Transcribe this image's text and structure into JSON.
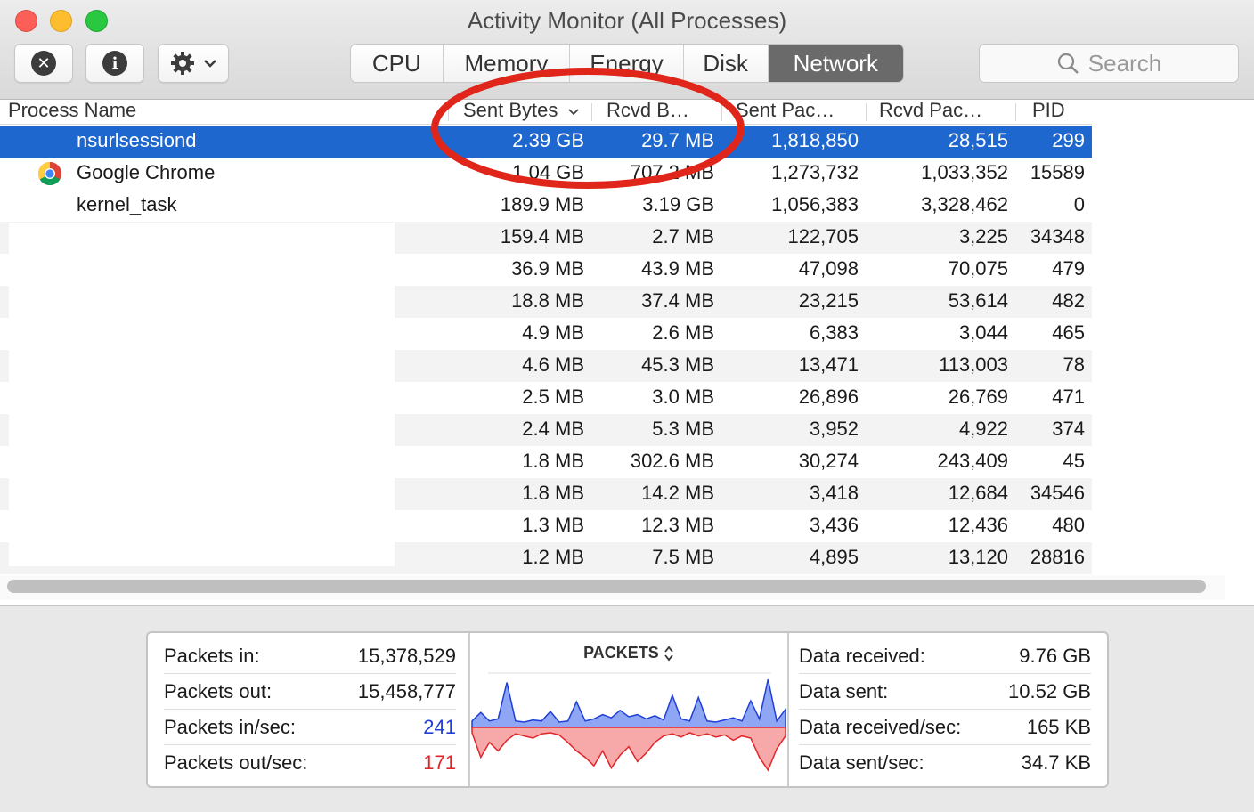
{
  "window": {
    "title": "Activity Monitor (All Processes)"
  },
  "toolbar": {
    "stop_icon": "x-circle-icon",
    "info_icon": "info-circle-icon",
    "gear_icon": "gear-icon"
  },
  "tabs": [
    {
      "label": "CPU",
      "active": false
    },
    {
      "label": "Memory",
      "active": false
    },
    {
      "label": "Energy",
      "active": false
    },
    {
      "label": "Disk",
      "active": false
    },
    {
      "label": "Network",
      "active": true
    }
  ],
  "search": {
    "placeholder": "Search"
  },
  "table": {
    "columns": {
      "process_name": "Process Name",
      "sent_bytes": "Sent Bytes",
      "rcvd_bytes": "Rcvd B…",
      "sent_packets": "Sent Pac…",
      "rcvd_packets": "Rcvd Pac…",
      "pid": "PID"
    },
    "sort_column": "Sent Bytes",
    "sort_direction": "descending",
    "rows": [
      {
        "name": "nsurlsessiond",
        "sent": "2.39 GB",
        "rcvd": "29.7 MB",
        "spk": "1,818,850",
        "rpk": "28,515",
        "pid": "299",
        "selected": true
      },
      {
        "name": "Google Chrome",
        "sent": "1.04 GB",
        "rcvd": "707.2 MB",
        "spk": "1,273,732",
        "rpk": "1,033,352",
        "pid": "15589",
        "icon": "chrome-icon"
      },
      {
        "name": "kernel_task",
        "sent": "189.9 MB",
        "rcvd": "3.19 GB",
        "spk": "1,056,383",
        "rpk": "3,328,462",
        "pid": "0"
      },
      {
        "name": "",
        "sent": "159.4 MB",
        "rcvd": "2.7 MB",
        "spk": "122,705",
        "rpk": "3,225",
        "pid": "34348"
      },
      {
        "name": "",
        "sent": "36.9 MB",
        "rcvd": "43.9 MB",
        "spk": "47,098",
        "rpk": "70,075",
        "pid": "479"
      },
      {
        "name": "",
        "sent": "18.8 MB",
        "rcvd": "37.4 MB",
        "spk": "23,215",
        "rpk": "53,614",
        "pid": "482"
      },
      {
        "name": "",
        "sent": "4.9 MB",
        "rcvd": "2.6 MB",
        "spk": "6,383",
        "rpk": "3,044",
        "pid": "465"
      },
      {
        "name": "",
        "sent": "4.6 MB",
        "rcvd": "45.3 MB",
        "spk": "13,471",
        "rpk": "113,003",
        "pid": "78"
      },
      {
        "name": "",
        "sent": "2.5 MB",
        "rcvd": "3.0 MB",
        "spk": "26,896",
        "rpk": "26,769",
        "pid": "471"
      },
      {
        "name": "",
        "sent": "2.4 MB",
        "rcvd": "5.3 MB",
        "spk": "3,952",
        "rpk": "4,922",
        "pid": "374"
      },
      {
        "name": "",
        "sent": "1.8 MB",
        "rcvd": "302.6 MB",
        "spk": "30,274",
        "rpk": "243,409",
        "pid": "45"
      },
      {
        "name": "",
        "sent": "1.8 MB",
        "rcvd": "14.2 MB",
        "spk": "3,418",
        "rpk": "12,684",
        "pid": "34546"
      },
      {
        "name": "",
        "sent": "1.3 MB",
        "rcvd": "12.3 MB",
        "spk": "3,436",
        "rpk": "12,436",
        "pid": "480"
      },
      {
        "name": "",
        "sent": "1.2 MB",
        "rcvd": "7.5 MB",
        "spk": "4,895",
        "rpk": "13,120",
        "pid": "28816"
      }
    ]
  },
  "stats_left": [
    {
      "label": "Packets in:",
      "value": "15,378,529",
      "color": "#1a1a1a"
    },
    {
      "label": "Packets out:",
      "value": "15,458,777",
      "color": "#1a1a1a"
    },
    {
      "label": "Packets in/sec:",
      "value": "241",
      "color": "#1f3fd6"
    },
    {
      "label": "Packets out/sec:",
      "value": "171",
      "color": "#e0262b"
    }
  ],
  "graph": {
    "title": "PACKETS",
    "in_color": "#1f3fd6",
    "out_color": "#e0262b",
    "in_values": [
      6,
      14,
      6,
      8,
      42,
      6,
      5,
      7,
      6,
      15,
      5,
      6,
      24,
      6,
      8,
      12,
      9,
      16,
      10,
      12,
      8,
      11,
      7,
      30,
      8,
      6,
      28,
      6,
      5,
      7,
      9,
      6,
      25,
      8,
      45,
      6,
      17
    ],
    "out_values": [
      5,
      28,
      14,
      22,
      12,
      6,
      8,
      10,
      6,
      5,
      7,
      14,
      22,
      28,
      36,
      22,
      38,
      26,
      18,
      32,
      24,
      14,
      8,
      6,
      9,
      5,
      8,
      6,
      9,
      7,
      12,
      8,
      10,
      28,
      40,
      20,
      8
    ]
  },
  "stats_right": [
    {
      "label": "Data received:",
      "value": "9.76 GB"
    },
    {
      "label": "Data sent:",
      "value": "10.52 GB"
    },
    {
      "label": "Data received/sec:",
      "value": "165 KB"
    },
    {
      "label": "Data sent/sec:",
      "value": "34.7 KB"
    }
  ],
  "annotation": {
    "color": "#e0261b"
  }
}
